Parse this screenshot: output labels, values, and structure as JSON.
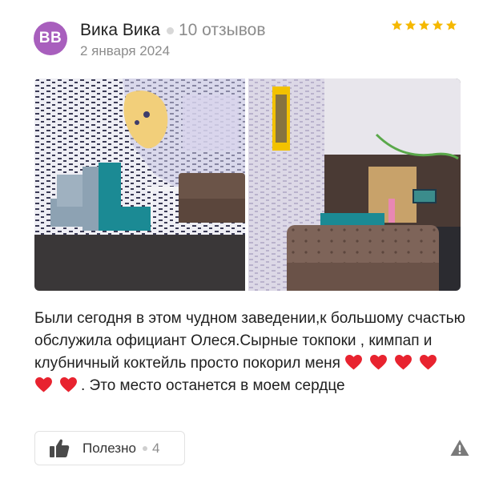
{
  "review": {
    "avatar_initials": "ВВ",
    "author": "Вика Вика",
    "reviews_count": "10 отзывов",
    "date": "2 января 2024",
    "rating": 5,
    "text_part1": "Были сегодня в этом чудном заведении,к большому счастью обслужила официант Олеся.Сырные токпоки , кимпап и клубничный коктейль просто покорил меня ",
    "text_part2": ". Это место останется в моем сердце",
    "hearts_count": 6
  },
  "actions": {
    "useful_label": "Полезно",
    "useful_count": "4"
  },
  "colors": {
    "avatar": "#a85fbd",
    "star": "#f5b800",
    "heart": "#e8232f",
    "muted_text": "#8c8c8c"
  },
  "icons": [
    "star-icon",
    "heart-icon",
    "thumbs-up-icon",
    "warning-icon"
  ]
}
